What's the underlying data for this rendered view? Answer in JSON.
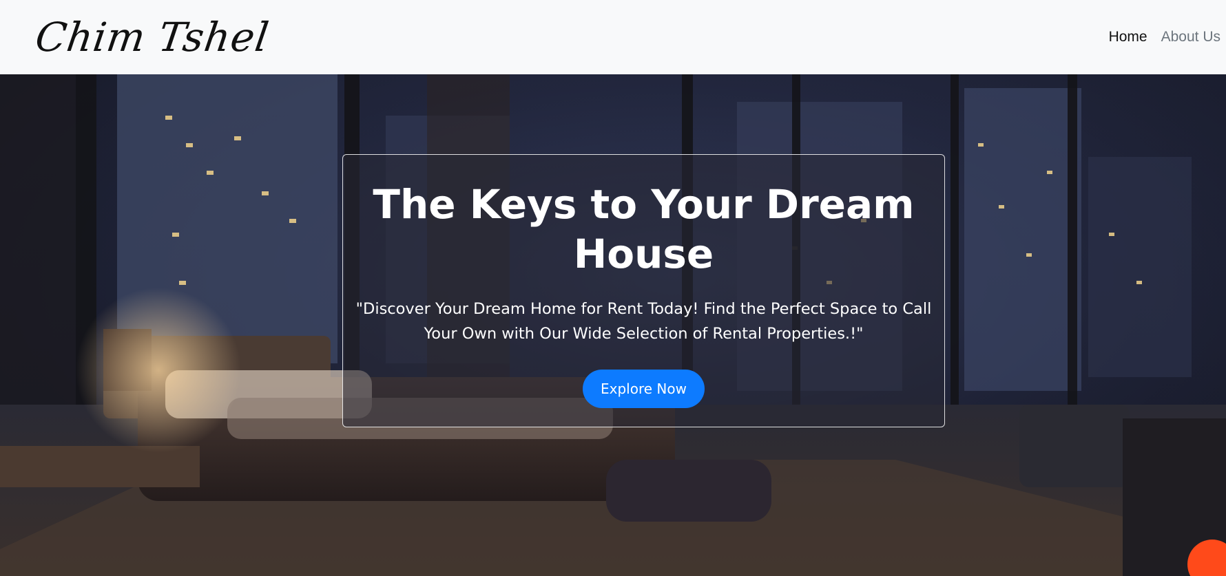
{
  "navbar": {
    "brand": "Chim Tshel",
    "links": [
      {
        "label": "Home",
        "active": true
      },
      {
        "label": "About Us",
        "active": false
      }
    ]
  },
  "hero": {
    "title": "The Keys to Your Dream House",
    "tagline": "\"Discover Your Dream Home for Rent Today! Find the Perfect Space to Call Your Own with Our Wide Selection of Rental Properties.!\"",
    "cta_label": "Explore Now"
  },
  "colors": {
    "navbar_bg": "#f8f9fa",
    "button_bg": "#0d7bff",
    "link_muted": "#6c757d",
    "link_active": "#111111"
  }
}
